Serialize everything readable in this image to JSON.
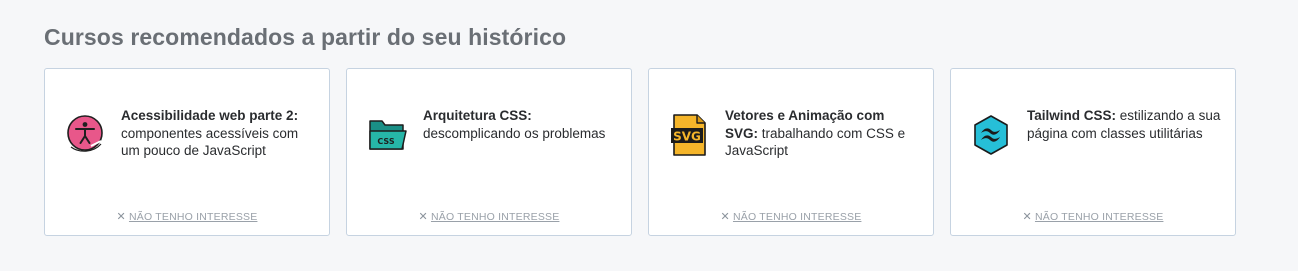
{
  "section": {
    "title": "Cursos recomendados a partir do seu histórico"
  },
  "colors": {
    "card_border": "#c6d3e1",
    "title": "#6a6f75",
    "dismiss": "#9aa1a9"
  },
  "courses": [
    {
      "icon": "accessibility-icon",
      "title_bold": "Acessibilidade web parte 2:",
      "title_rest": " componentes acessíveis com um pouco de JavaScript",
      "dismiss_label": "NÃO TENHO INTERESSE"
    },
    {
      "icon": "css-folder-icon",
      "icon_text": "CSS",
      "title_bold": "Arquitetura CSS:",
      "title_rest": " descomplicando os problemas",
      "dismiss_label": "NÃO TENHO INTERESSE"
    },
    {
      "icon": "svg-file-icon",
      "icon_text": "SVG",
      "title_bold": "Vetores e Animação com SVG:",
      "title_rest": " trabalhando com CSS e JavaScript",
      "dismiss_label": "NÃO TENHO INTERESSE"
    },
    {
      "icon": "tailwind-icon",
      "title_bold": "Tailwind CSS:",
      "title_rest": " estilizando a sua página com classes utilitárias",
      "dismiss_label": "NÃO TENHO INTERESSE"
    }
  ]
}
